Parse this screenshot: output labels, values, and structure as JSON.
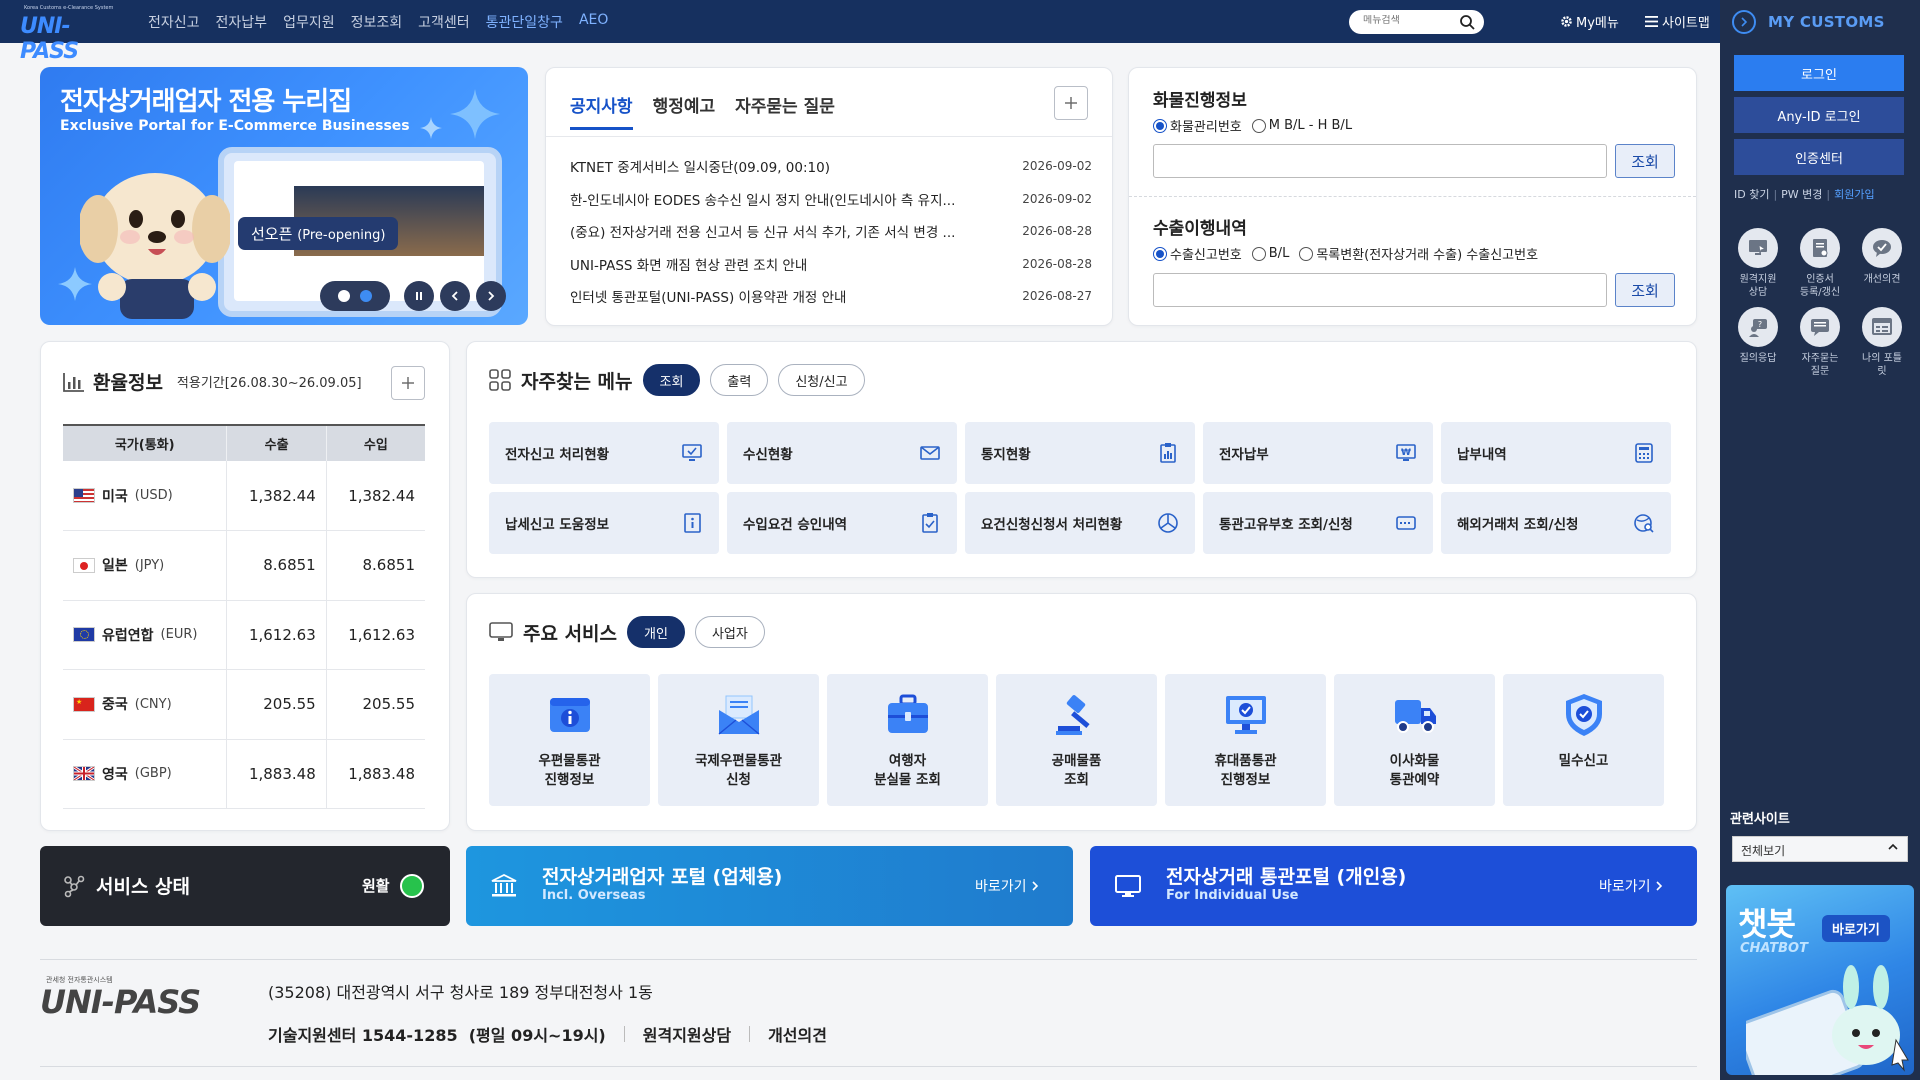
{
  "header": {
    "logo_sub": "Korea Customs e-Clearance System",
    "logo_text": "UNI-PASS",
    "menu": [
      "전자신고",
      "전자납부",
      "업무지원",
      "정보조회",
      "고객센터",
      "통관단일창구",
      "AEO"
    ],
    "search_placeholder": "메뉴검색",
    "mymenu": "My메뉴",
    "sitemap": "사이트맵"
  },
  "sidebar": {
    "title": "MY CUSTOMS",
    "login": "로그인",
    "anyid": "Any-ID 로그인",
    "cert": "인증센터",
    "links": [
      "ID 찾기",
      "PW 변경",
      "회원가입"
    ],
    "icons": [
      {
        "label": "원격지원\n상담",
        "icon": "remote-support-icon"
      },
      {
        "label": "인증서\n등록/갱신",
        "icon": "certificate-icon"
      },
      {
        "label": "개선의견",
        "icon": "chat-bubble-icon"
      },
      {
        "label": "질의응답",
        "icon": "qna-icon"
      },
      {
        "label": "자주묻는\n질문",
        "icon": "faq-icon"
      },
      {
        "label": "나의 포틀\n릿",
        "icon": "portlet-icon"
      }
    ],
    "related_title": "관련사이트",
    "related_select": "전체보기",
    "chatbot_title": "챗봇",
    "chatbot_sub": "CHATBOT",
    "chatbot_go": "바로가기"
  },
  "banner": {
    "title": "전자상거래업자 전용 누리집",
    "subtitle": "Exclusive Portal for E-Commerce Businesses",
    "preopen": "선오픈",
    "preopen_en": "(Pre-opening)"
  },
  "notice": {
    "tabs": [
      "공지사항",
      "행정예고",
      "자주묻는 질문"
    ],
    "items": [
      {
        "title": "KTNET 중계서비스 일시중단(09.09, 00:10)",
        "date": "2026-09-02"
      },
      {
        "title": "한-인도네시아 EODES 송수신 일시 정지 안내(인도네시아 측 유지...",
        "date": "2026-09-02"
      },
      {
        "title": "(중요) 전자상거래 전용 신고서 등 신규 서식 추가, 기존 서식 변경 ...",
        "date": "2026-08-28"
      },
      {
        "title": "UNI-PASS 화면 깨짐 현상 관련 조치 안내",
        "date": "2026-08-28"
      },
      {
        "title": "인터넷 통관포털(UNI-PASS) 이용약관 개정 안내",
        "date": "2026-08-27"
      }
    ]
  },
  "cargo": {
    "title": "화물진행정보",
    "options": [
      "화물관리번호",
      "M B/L - H B/L"
    ],
    "button": "조회"
  },
  "export": {
    "title": "수출이행내역",
    "options": [
      "수출신고번호",
      "B/L",
      "목록변환(전자상거래 수출) 수출신고번호"
    ],
    "button": "조회"
  },
  "exchange": {
    "title": "환율정보",
    "period": "적용기간[26.08.30~26.09.05]",
    "headers": [
      "국가(통화)",
      "수출",
      "수입"
    ],
    "rows": [
      {
        "country": "미국",
        "code": "(USD)",
        "export": "1,382.44",
        "import": "1,382.44",
        "flag": "us"
      },
      {
        "country": "일본",
        "code": "(JPY)",
        "export": "8.6851",
        "import": "8.6851",
        "flag": "jp"
      },
      {
        "country": "유럽연합",
        "code": "(EUR)",
        "export": "1,612.63",
        "import": "1,612.63",
        "flag": "eu"
      },
      {
        "country": "중국",
        "code": "(CNY)",
        "export": "205.55",
        "import": "205.55",
        "flag": "cn"
      },
      {
        "country": "영국",
        "code": "(GBP)",
        "export": "1,883.48",
        "import": "1,883.48",
        "flag": "gb"
      }
    ]
  },
  "favorites": {
    "title": "자주찾는 메뉴",
    "pills": [
      "조회",
      "출력",
      "신청/신고"
    ],
    "items": [
      {
        "label": "전자신고 처리현황",
        "icon": "monitor-check-icon"
      },
      {
        "label": "수신현황",
        "icon": "mail-icon"
      },
      {
        "label": "통지현황",
        "icon": "clipboard-chart-icon"
      },
      {
        "label": "전자납부",
        "icon": "won-monitor-icon"
      },
      {
        "label": "납부내역",
        "icon": "calculator-icon"
      },
      {
        "label": "납세신고 도움정보",
        "icon": "info-book-icon"
      },
      {
        "label": "수입요건 승인내역",
        "icon": "clipboard-check-icon"
      },
      {
        "label": "요건신청신청서 처리현황",
        "icon": "progress-icon"
      },
      {
        "label": "통관고유부호 조회/신청",
        "icon": "id-card-icon"
      },
      {
        "label": "해외거래처 조회/신청",
        "icon": "globe-search-icon"
      }
    ]
  },
  "services": {
    "title": "주요 서비스",
    "pills": [
      "개인",
      "사업자"
    ],
    "items": [
      {
        "label": "우편물통관\n진행정보",
        "icon": "postal-info-icon"
      },
      {
        "label": "국제우편물통관\n신청",
        "icon": "envelope-icon"
      },
      {
        "label": "여행자\n분실물 조회",
        "icon": "suitcase-icon"
      },
      {
        "label": "공매물품\n조회",
        "icon": "gavel-icon"
      },
      {
        "label": "휴대품통관\n진행정보",
        "icon": "carry-on-icon"
      },
      {
        "label": "이사화물\n통관예약",
        "icon": "truck-icon"
      },
      {
        "label": "밀수신고",
        "icon": "shield-check-icon"
      }
    ]
  },
  "status": {
    "title": "서비스 상태",
    "value": "원활"
  },
  "portals": [
    {
      "title": "전자상거래업자 포털 (업체용)",
      "sub": "Incl. Overseas",
      "go": "바로가기"
    },
    {
      "title": "전자상거래 통관포털 (개인용)",
      "sub": "For Individual Use",
      "go": "바로가기"
    }
  ],
  "footer": {
    "logo_sub": "관세청 전자통관시스템",
    "logo_text": "UNI-PASS",
    "address": "(35208) 대전광역시 서구 청사로 189 정부대전청사 1동",
    "links": [
      "기술지원센터 1544-1285  (평일 09시~19시)",
      "원격지원상담",
      "개선의견"
    ]
  },
  "colors": {
    "nav": "#16305f",
    "accent": "#1652c8",
    "sidebar": "#1f2f4d",
    "status_ok": "#27c24c"
  }
}
